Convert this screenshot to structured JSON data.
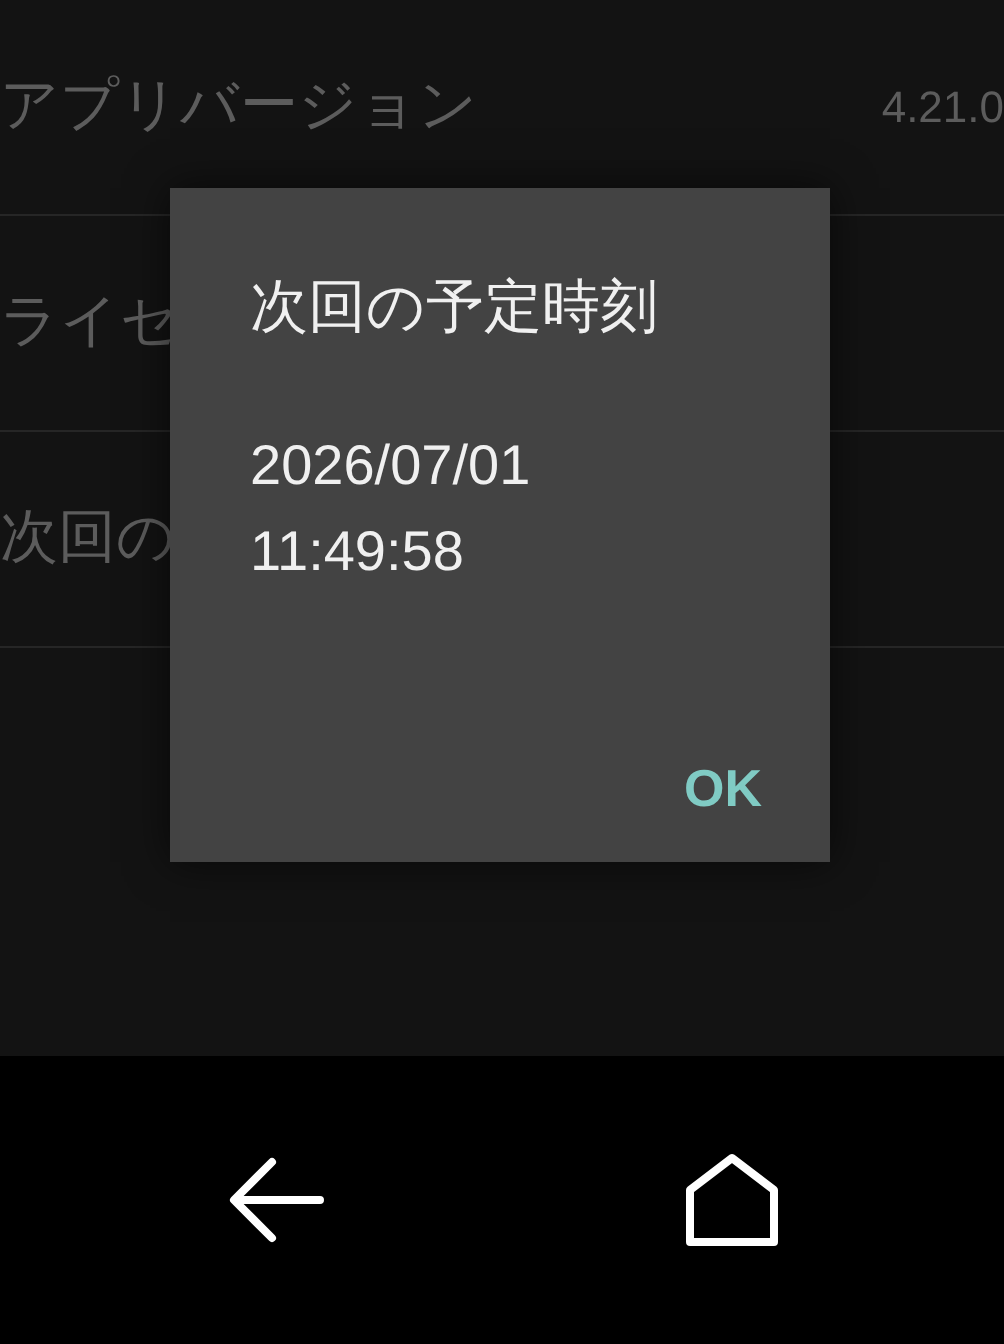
{
  "settings_rows": [
    {
      "label": "アプリバージョン",
      "value": "4.21.0"
    },
    {
      "label": "ライセ"
    },
    {
      "label": "次回の"
    }
  ],
  "dialog": {
    "title": "次回の予定時刻",
    "message_lines": [
      "2026/07/01",
      "11:49:58"
    ],
    "buttons": [
      "OK"
    ]
  },
  "navigation_bar": {
    "buttons": [
      {
        "kind": "back"
      },
      {
        "kind": "home"
      }
    ]
  }
}
